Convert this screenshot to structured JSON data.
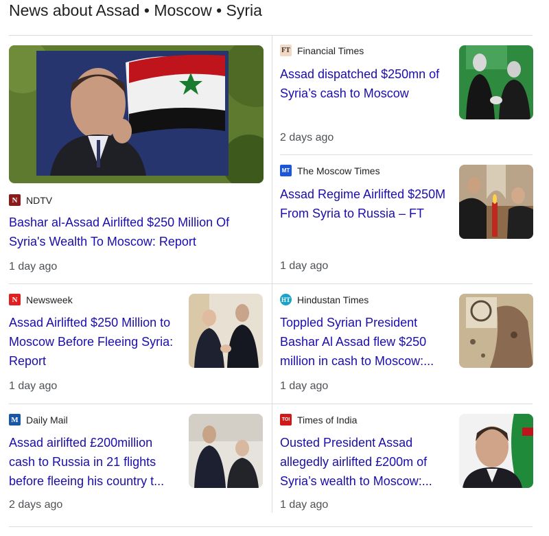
{
  "heading": "News about Assad • Moscow • Syria",
  "cards": [
    {
      "source": "NDTV",
      "logo": "N",
      "logo_color": "#8b1a1a",
      "title": "Bashar al-Assad Airlifted $250 Million Of Syria's Wealth To Moscow: Report",
      "time": "1 day ago",
      "image": "assad-pointing-billboard-image"
    },
    {
      "source": "Financial Times",
      "logo": "FT",
      "logo_color": "#f2d9c4",
      "title": "Assad dispatched $250mn of Syria’s cash to Moscow",
      "time": "2 days ago",
      "image": "assad-putin-handshake-image"
    },
    {
      "source": "The Moscow Times",
      "logo": "MT",
      "logo_color": "#1a56db",
      "title": "Assad Regime Airlifted $250M From Syria to Russia – FT",
      "time": "1 day ago",
      "image": "assad-putin-candles-image"
    },
    {
      "source": "Newsweek",
      "logo": "N",
      "logo_color": "#e02020",
      "title": "Assad Airlifted $250 Million to Moscow Before Fleeing Syria: Report",
      "time": "1 day ago",
      "image": "putin-assad-handshake-image"
    },
    {
      "source": "Hindustan Times",
      "logo": "HT",
      "logo_color": "#1aa3c9",
      "title": "Toppled Syrian President Bashar Al Assad flew $250 million in cash to Moscow:...",
      "time": "1 day ago",
      "image": "torn-poster-image"
    },
    {
      "source": "Daily Mail",
      "logo": "M",
      "logo_color": "#1a56a8",
      "title": "Assad airlifted £200million cash to Russia in 21 flights before fleeing his country t...",
      "time": "2 days ago",
      "image": "assad-putin-meeting-image"
    },
    {
      "source": "Times of India",
      "logo": "TOI",
      "logo_color": "#d01919",
      "title": "Ousted President Assad allegedly airlifted £200m of Syria’s wealth to Moscow:...",
      "time": "1 day ago",
      "image": "assad-portrait-image"
    }
  ]
}
